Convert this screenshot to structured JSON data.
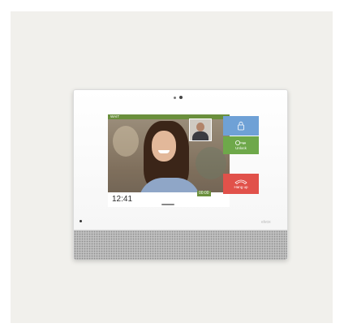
{
  "screen": {
    "status_label": "WAIT",
    "clock": "12:41",
    "call_timer": "00:00"
  },
  "buttons": {
    "unlock_label": "Unlock",
    "hangup_label": "Hang up"
  },
  "brand": {
    "logo_text": "elvox"
  },
  "icons": {
    "lock": "lock-icon",
    "key": "key-icon",
    "hangup": "phone-hangup-icon"
  },
  "colors": {
    "lock_button": "#6fa1d6",
    "unlock_button": "#6ea84a",
    "hangup_button": "#e1514a",
    "status_bar": "#6a8f3c"
  }
}
